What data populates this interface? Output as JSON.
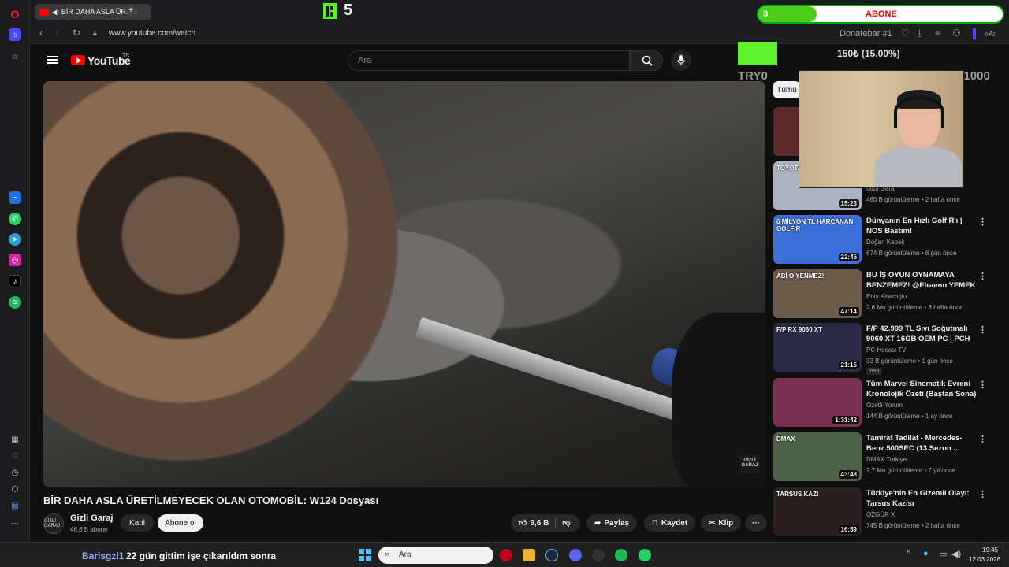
{
  "browser": {
    "tab_title": "BİR DAHA ASLA ÜRETİ",
    "url": "www.youtube.com/watch"
  },
  "youtube": {
    "logo_text": "YouTube",
    "region": "TR",
    "search_placeholder": "Ara"
  },
  "video": {
    "title": "BİR DAHA ASLA ÜRETİLMEYECEK OLAN OTOMOBİL: W124 Dosyası",
    "watermark": "GİZLİ GARAJ",
    "channel": "Gizli Garaj",
    "subscribers": "46,6 B abone",
    "join_label": "Katıl",
    "subscribe_label": "Abone ol",
    "likes": "9,6 B",
    "share_label": "Paylaş",
    "save_label": "Kaydet",
    "clip_label": "Klip",
    "avatar_text": "GİZLİ GARAJ"
  },
  "chips": {
    "all": "Tümü"
  },
  "recommendations": [
    {
      "title": "",
      "channel": "",
      "meta": "",
      "duration": "",
      "thumb_color": "#5a2a2a"
    },
    {
      "title": "",
      "channel": "Gizli Garaj",
      "meta": "460 B görüntüleme • 2 hafta önce",
      "duration": "15:23",
      "thumb_color": "#aab4c0",
      "thumb_text": "TOYOTA"
    },
    {
      "title": "Dünyanın En Hızlı Golf R'ı | NOS Bastım!",
      "channel": "Doğan Kabak",
      "meta": "674 B görüntüleme • 8 gün önce",
      "duration": "22:45",
      "thumb_color": "#3c6fd8",
      "thumb_text": "6 MİLYON TL HARCANAN GOLF R"
    },
    {
      "title": "BU İŞ OYUN OYNAMAYA BENZEMEZ! @Elraenn YEMEK ...",
      "channel": "Enis Kirazoglu",
      "meta": "2,6 Mn görüntüleme • 3 hafta önce",
      "duration": "47:14",
      "thumb_color": "#6b5b4b",
      "thumb_text": "ABİ O YENMEZ!"
    },
    {
      "title": "F/P 42.999 TL Sıvı Soğutmalı 9060 XT 16GB OEM PC | PCH ...",
      "channel": "PC Hocası TV",
      "meta": "33 B görüntüleme • 1 gün önce",
      "duration": "21:15",
      "thumb_color": "#2a2a44",
      "thumb_text": "F/P RX 9060 XT",
      "badge": "Yeni"
    },
    {
      "title": "Tüm Marvel Sinematik Evreni Kronolojik Özeti (Baştan Sona)",
      "channel": "Özetli-Yorum",
      "meta": "144 B görüntüleme • 1 ay önce",
      "duration": "1:31:42",
      "thumb_color": "#7a3050"
    },
    {
      "title": "Tamirat Tadilat - Mercedes-Benz 500SEC (13.Sezon ...",
      "channel": "DMAX Turkiye",
      "meta": "2,7 Mn görüntüleme • 7 yıl önce",
      "duration": "43:48",
      "thumb_color": "#4d6048",
      "thumb_text": "DMAX"
    },
    {
      "title": "Türkiye'nin En Gizemli Olayı: Tarsus Kazısı",
      "channel": "ÖZGÜR X",
      "meta": "745 B görüntüleme • 2 hafta önce",
      "duration": "16:59",
      "thumb_color": "#2a2020",
      "thumb_text": "TARSUS KAZI"
    }
  ],
  "overlay": {
    "kick_number": "5",
    "subscriber_goal_count": "3",
    "subscriber_goal_label": "ABONE",
    "subscriber_goal_fill": 0.24,
    "donate_label": "Donatebar #1",
    "donate_amount": "150₺ (15.00%)",
    "donate_min": "TRY0",
    "donate_max": "TRY1000",
    "donate_fill": 0.15
  },
  "taskbar": {
    "ticker": "Barisgzl1 22 gün gittim işe çıkarıldım sonra",
    "ticker_user": "Barisgzl1",
    "ticker_text": "22 gün gittim işe çıkarıldım sonra",
    "search_placeholder": "Ara",
    "time": "19:45",
    "date": "12.03.2026"
  },
  "colors": {
    "yt_red": "#ff0000",
    "kick_green": "#53fc18",
    "abone_red": "#e00000"
  }
}
